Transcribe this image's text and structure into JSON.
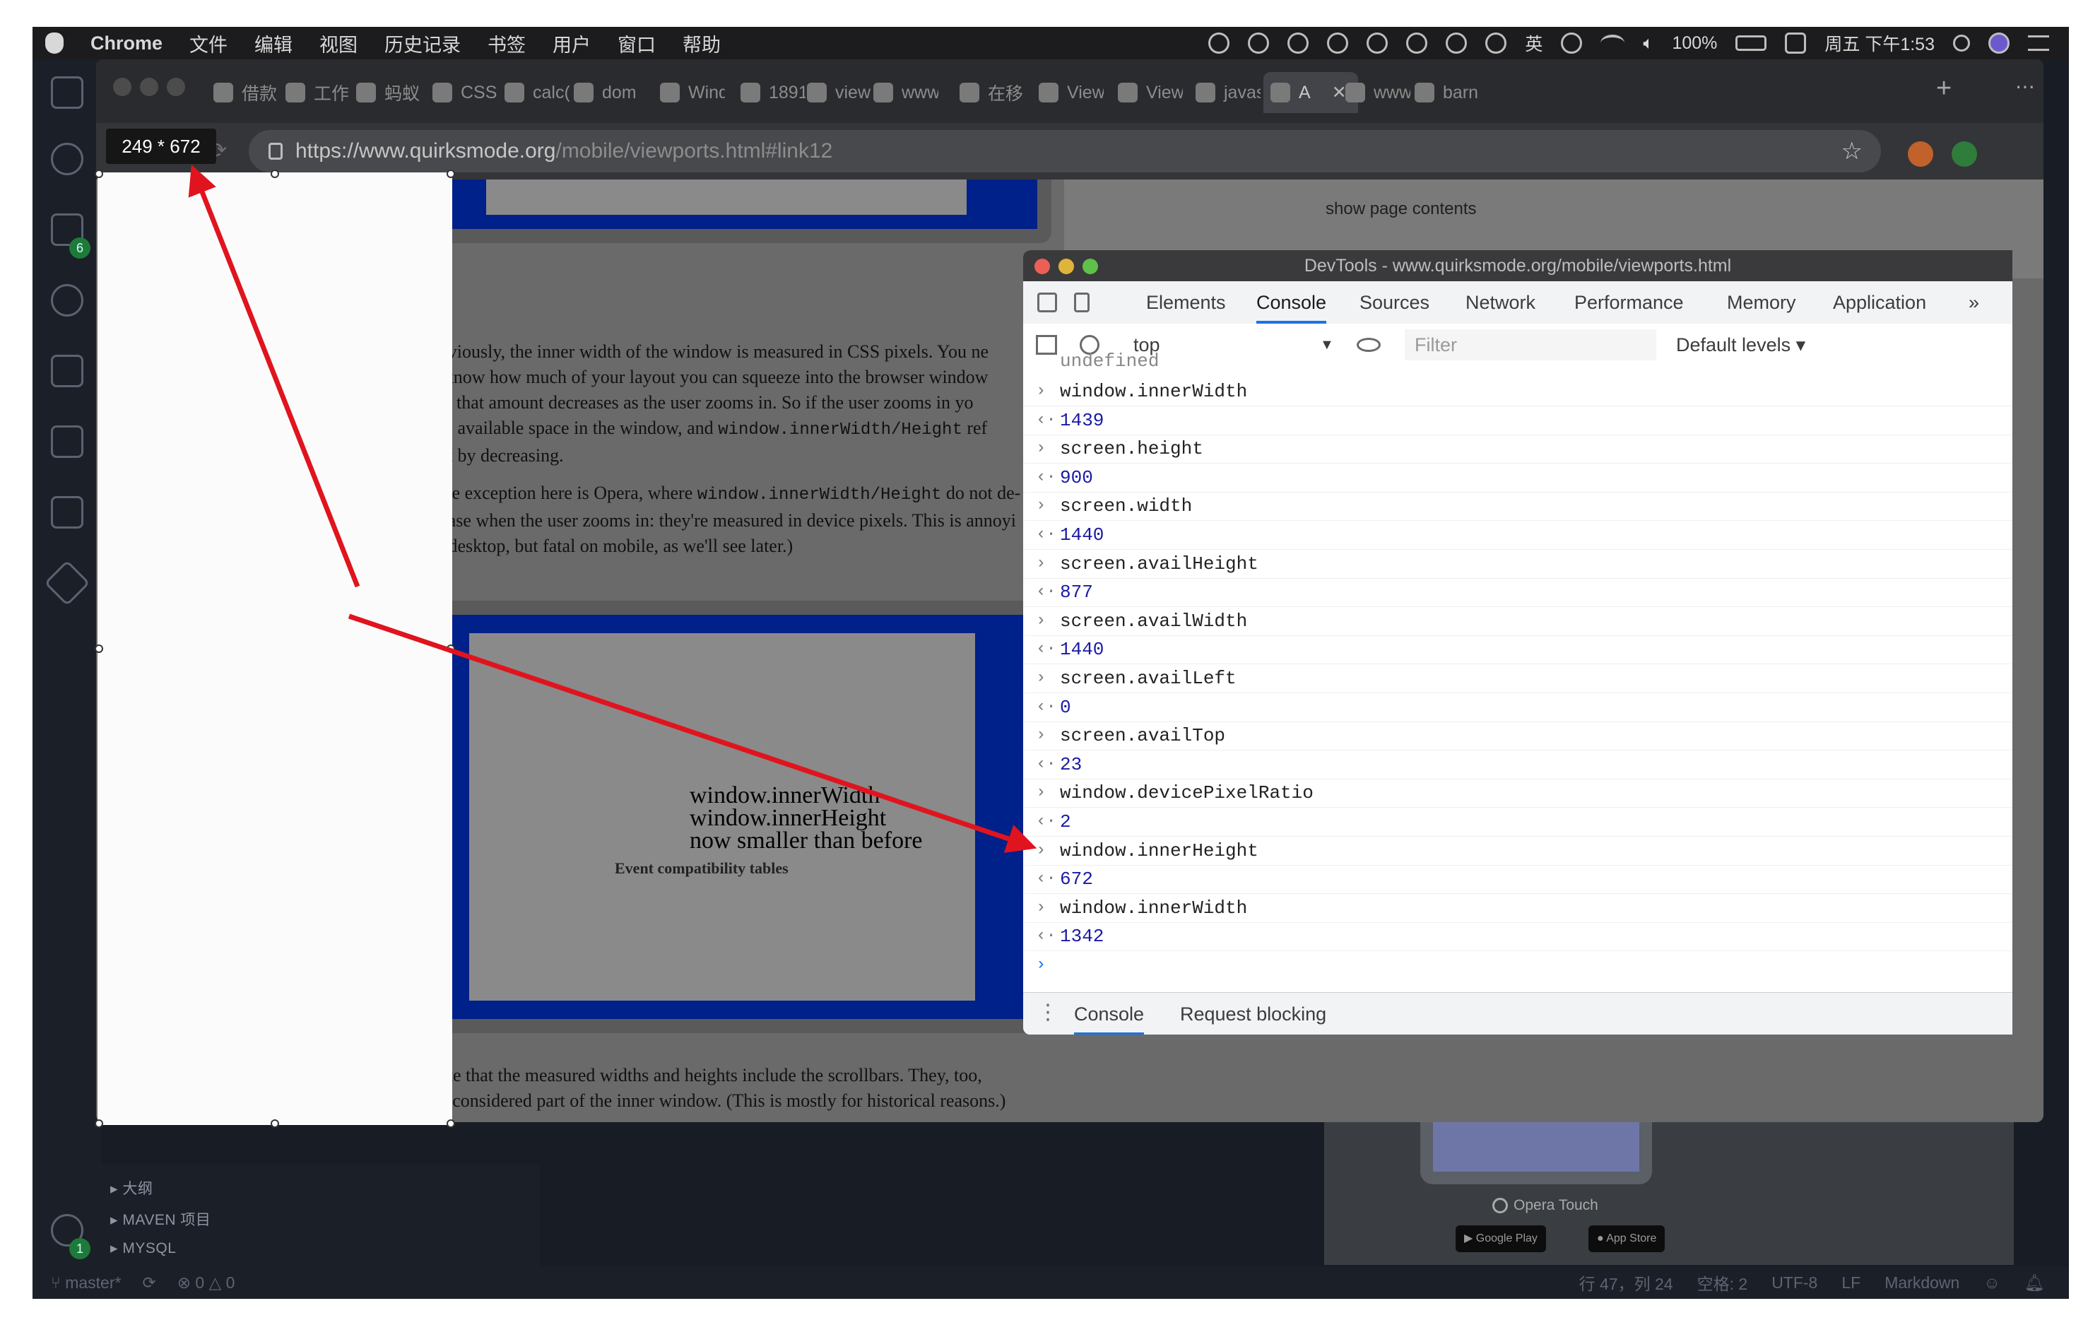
{
  "menubar": {
    "app": "Chrome",
    "items": [
      "文件",
      "编辑",
      "视图",
      "历史记录",
      "书签",
      "用户",
      "窗口",
      "帮助"
    ],
    "input_method": "英",
    "battery": "100%",
    "clock": "周五 下午1:53"
  },
  "tabs": [
    {
      "label": "借款"
    },
    {
      "label": "工作"
    },
    {
      "label": "蚂蚁"
    },
    {
      "label": "CSS"
    },
    {
      "label": "calc("
    },
    {
      "label": "dom"
    },
    {
      "label": "Wind"
    },
    {
      "label": "1891"
    },
    {
      "label": "view"
    },
    {
      "label": "www"
    },
    {
      "label": "在移"
    },
    {
      "label": "View"
    },
    {
      "label": "View"
    },
    {
      "label": "javas"
    },
    {
      "label": "A",
      "active": true
    },
    {
      "label": "www"
    },
    {
      "label": "barn"
    }
  ],
  "new_tab": "+",
  "omnibox": {
    "url_host": "https://www.quirksmode.org",
    "url_path": "/mobile/viewports.html#link12"
  },
  "selection": {
    "dimensions": "249 * 672"
  },
  "page": {
    "show_contents": "show page contents",
    "para1": [
      "Obviously, the inner width of the window is measured in CSS pixels. You ne",
      "to know how much of your layout you can squeeze into the browser window",
      "and that amount decreases as the user zooms in. So if the user zooms in yo",
      "less available space in the window, and ",
      "that by decreasing."
    ],
    "para1_code": "window.innerWidth/Height",
    "para1_tail": " ref",
    "para2": [
      "(The exception here is Opera, where ",
      "crease when the user zooms in: they're measured in device pixels. This is annoyi",
      "on desktop, but fatal on mobile, as we'll see later.)"
    ],
    "para2_code": "window.innerWidth/Height",
    "para2_tail": " do not de-",
    "figure_label": [
      "window.innerWidth",
      "window.innerHeight",
      "now smaller than before"
    ],
    "figure_heading": "Event compatibility tables",
    "para3": [
      "Note that the measured widths and heights include the scrollbars. They, too,",
      "are considered part of the inner window. (This is mostly for historical reasons.)"
    ]
  },
  "devtools": {
    "title": "DevTools - www.quirksmode.org/mobile/viewports.html",
    "tabs": [
      "Elements",
      "Console",
      "Sources",
      "Network",
      "Performance",
      "Memory",
      "Application",
      "»"
    ],
    "context": "top",
    "filter_placeholder": "Filter",
    "levels": "Default levels ▾",
    "console_lines": [
      {
        "kind": "in",
        "text": "window.innerWidth"
      },
      {
        "kind": "out",
        "text": "1439"
      },
      {
        "kind": "in",
        "text": "screen.height"
      },
      {
        "kind": "out",
        "text": "900"
      },
      {
        "kind": "in",
        "text": "screen.width"
      },
      {
        "kind": "out",
        "text": "1440"
      },
      {
        "kind": "in",
        "text": "screen.availHeight"
      },
      {
        "kind": "out",
        "text": "877"
      },
      {
        "kind": "in",
        "text": "screen.availWidth"
      },
      {
        "kind": "out",
        "text": "1440"
      },
      {
        "kind": "in",
        "text": "screen.availLeft"
      },
      {
        "kind": "out",
        "text": "0"
      },
      {
        "kind": "in",
        "text": "screen.availTop"
      },
      {
        "kind": "out",
        "text": "23"
      },
      {
        "kind": "in",
        "text": "window.devicePixelRatio"
      },
      {
        "kind": "out",
        "text": "2"
      },
      {
        "kind": "in",
        "text": "window.innerHeight"
      },
      {
        "kind": "out",
        "text": "672"
      },
      {
        "kind": "in",
        "text": "window.innerWidth"
      },
      {
        "kind": "out",
        "text": "1342"
      }
    ],
    "drawer_tabs": [
      "Console",
      "Request blocking"
    ]
  },
  "vscode": {
    "sections": [
      "大纲",
      "MAVEN 项目",
      "MYSQL"
    ],
    "badges": {
      "scm": "6",
      "settings": "1"
    },
    "status": {
      "branch": "master*",
      "errors": "0",
      "warnings": "0",
      "position": "行 47，列 24",
      "indent": "空格: 2",
      "encoding": "UTF-8",
      "eol": "LF",
      "language": "Markdown"
    },
    "preview": {
      "opera": "Opera Touch",
      "google_play": "Google Play",
      "app_store": "App Store"
    }
  },
  "colors": {
    "annotation_red": "#e0141e",
    "selection_fill": "#fbfbfb",
    "devtools_accent": "#1a73e8",
    "console_output": "#1a1aa6"
  }
}
